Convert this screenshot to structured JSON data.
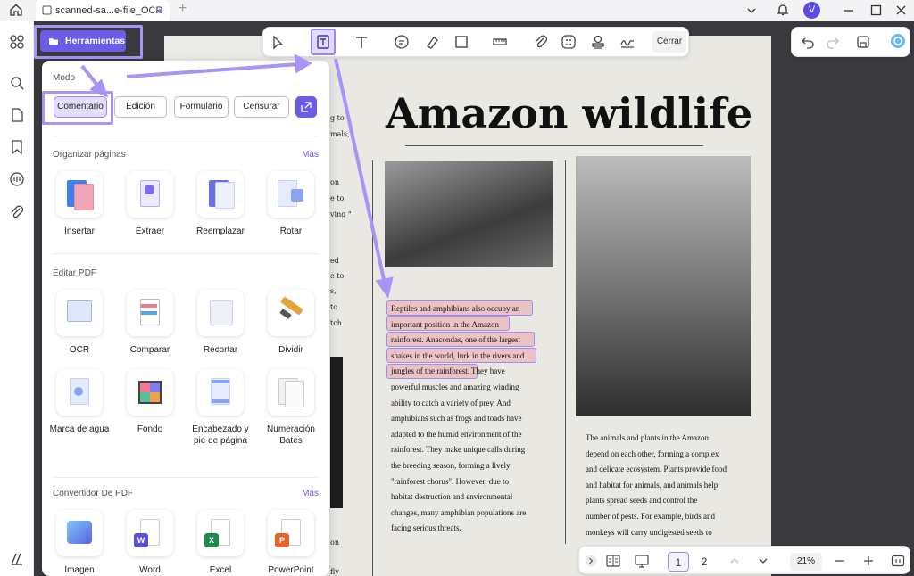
{
  "titlebar": {
    "tab_title": "scanned-sa...e-file_OCR",
    "avatar_letter": "V"
  },
  "tools_button": {
    "label": "Herramientas"
  },
  "panel": {
    "mode_label": "Modo",
    "modes": [
      "Comentario",
      "Edición",
      "Formulario",
      "Censurar"
    ],
    "selected_mode": "Comentario",
    "sections": [
      {
        "title": "Organizar páginas",
        "more": "Más",
        "tools": [
          "Insertar",
          "Extraer",
          "Reemplazar",
          "Rotar"
        ]
      },
      {
        "title": "Editar PDF",
        "more": "",
        "tools": [
          "OCR",
          "Comparar",
          "Recortar",
          "Dividir",
          "Marca de agua",
          "Fondo",
          "Encabezado y pie de página",
          "Numeración Bates"
        ]
      },
      {
        "title": "Convertidor De PDF",
        "more": "Más",
        "tools": [
          "Imagen",
          "Word",
          "Excel",
          "PowerPoint"
        ]
      }
    ]
  },
  "toolbar": {
    "close_label": "Cerrar"
  },
  "bottombar": {
    "pages": [
      "1",
      "2"
    ],
    "current_page": "1",
    "zoom": "21%"
  },
  "document": {
    "title": "Amazon wildlife",
    "left_fragments": [
      "g to",
      "mals,",
      "on",
      "e to",
      "ving \"",
      "ed",
      "e to",
      "s,",
      "to",
      "tch",
      "on",
      "fly"
    ],
    "highlighted_text": [
      "Reptiles and amphibians also occupy an",
      "important position in the Amazon",
      "rainforest. Anacondas, one of the largest",
      "snakes in the world, lurk in the rivers and",
      "jungles of the rainforest."
    ],
    "column1_text": [
      "Reptiles and amphibians also occupy an",
      "important position in the Amazon",
      "rainforest. Anacondas, one of the largest",
      "snakes in the world, lurk in the rivers and",
      "jungles of the rainforest. They have",
      "powerful muscles and amazing winding",
      "ability to catch a variety of prey. And",
      "amphibians such as frogs and toads have",
      "adapted to the humid environment of the",
      "rainforest. They make unique calls during",
      "the breeding season, forming a lively",
      "\"rainforest chorus\". However, due to",
      "habitat destruction and environmental",
      "changes, many amphibian populations are",
      "facing serious threats."
    ],
    "column2_text": [
      "The animals and plants in the Amazon",
      "depend on each other, forming a complex",
      "and delicate ecosystem. Plants provide food",
      "and habitat for animals, and animals help",
      "plants spread seeds and control the",
      "number of pests. For example, birds and",
      "monkeys will carry undigested seeds to"
    ]
  },
  "colors": {
    "accent": "#6b5ce7",
    "annotation": "#a893f7",
    "highlight": "#f096a0"
  }
}
